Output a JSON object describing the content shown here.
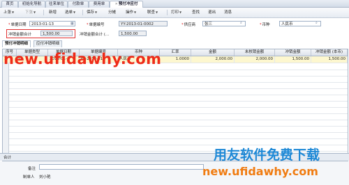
{
  "tabs": [
    "首页",
    "初始化导航",
    "往来单位",
    "付款单",
    "费用单",
    "预付冲应付"
  ],
  "toolbar": {
    "items": [
      "上张",
      "下张",
      "新增",
      "选单",
      "保存",
      "分摊",
      "操作",
      "联查",
      "打印",
      "查找",
      "退出",
      "消息"
    ]
  },
  "form": {
    "date_label": "单据日期",
    "date_value": "2013-01-13",
    "docno_label": "单据编号",
    "docno_value": "YY-2013-01-0002",
    "supplier_label": "供应商",
    "supplier_value": "张三",
    "currency_label": "币种",
    "currency_value": "人民币",
    "offset_total_label": "冲销金额合计",
    "offset_total_value": "1,500.00",
    "offset_total2_label": "冲销金额合计 (…",
    "offset_total2_value": "1,500.00"
  },
  "subtabs": [
    "预付冲销明细",
    "应付冲销明细"
  ],
  "grid": {
    "columns": [
      "序号",
      "单据类型",
      "单据日期",
      "单据编号",
      "币种",
      "汇率",
      "金额",
      "未核销金额",
      "冲销金额",
      "冲销金额 (本币)"
    ],
    "rows": [
      {
        "no": "1",
        "type": "付",
        "date": "2013-01-1",
        "docno": "FK-2013-01-",
        "currency": "人民币",
        "rate": "1.0000",
        "amount": "2,000.00",
        "unverified": "2,000.00",
        "offset": "1,500.00",
        "offset_local": "1,500.00"
      }
    ],
    "total_label": "合计"
  },
  "footer": {
    "remark_label": "备注",
    "maker_label": "制单人",
    "maker_value": "刘小艳"
  },
  "watermark": {
    "url": "new.ufidawhy.com",
    "title": "用友软件免费下载",
    "url2": "new.ufidawhy.com"
  },
  "colors": {
    "selected_row": "#fdf7cf",
    "watermark_red": "#ef2b18",
    "watermark_blue": "#1d88d6",
    "watermark_orange": "#f07c12",
    "highlight_box": "#e03030"
  }
}
